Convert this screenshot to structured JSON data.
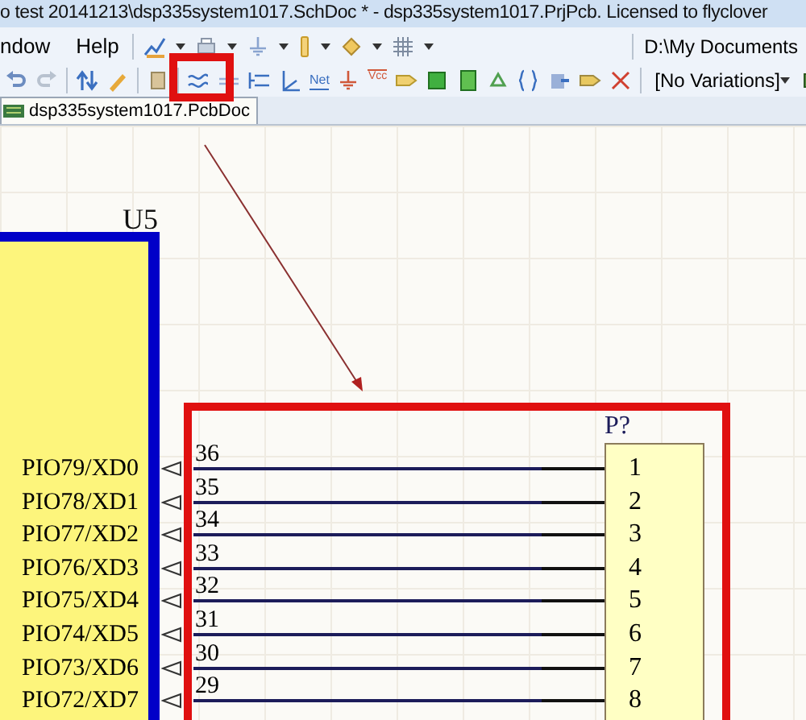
{
  "window": {
    "title": "o test 20141213\\dsp335system1017.SchDoc * - dsp335system1017.PrjPcb. Licensed to flyclover"
  },
  "menu": [
    {
      "label": "ndow"
    },
    {
      "label": "Help"
    }
  ],
  "path_field": {
    "value": "D:\\My Documents"
  },
  "toolbar": {
    "net_label_button": "Net",
    "power_port_button": "Vcc"
  },
  "variants_dropdown": {
    "value": "[No Variations]"
  },
  "tabs": [
    {
      "label": "dsp335system1017.PcbDoc",
      "selected": true
    }
  ],
  "schematic": {
    "u5": {
      "designator": "U5",
      "pins": [
        {
          "name": "PIO79/XD0",
          "number": "36"
        },
        {
          "name": "PIO78/XD1",
          "number": "35"
        },
        {
          "name": "PIO77/XD2",
          "number": "34"
        },
        {
          "name": "PIO76/XD3",
          "number": "33"
        },
        {
          "name": "PIO75/XD4",
          "number": "32"
        },
        {
          "name": "PIO74/XD5",
          "number": "31"
        },
        {
          "name": "PIO73/XD6",
          "number": "30"
        },
        {
          "name": "PIO72/XD7",
          "number": "29"
        }
      ]
    },
    "connector": {
      "designator": "P?",
      "pins": [
        "1",
        "2",
        "3",
        "4",
        "5",
        "6",
        "7",
        "8"
      ]
    }
  }
}
